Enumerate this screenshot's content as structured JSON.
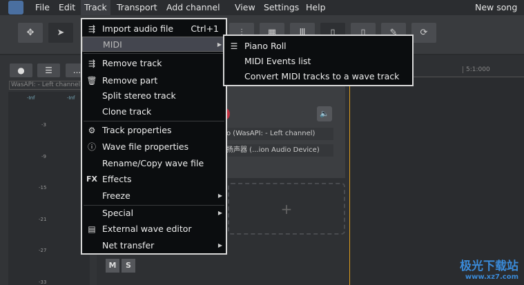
{
  "menubar": {
    "items": [
      "File",
      "Edit",
      "Track",
      "Transport",
      "Add channel",
      "View",
      "Settings",
      "Help"
    ],
    "song_title": "New song"
  },
  "left_panel": {
    "input_label": "WasAPI: - Left channel",
    "meter_left": "-Inf",
    "meter_right": "-Inf",
    "scale": [
      "-3",
      "-9",
      "-15",
      "-21",
      "-27",
      "-33"
    ],
    "more": "..."
  },
  "track": {
    "input_select": "o (WasAPI: - Left channel)",
    "output_select": "扬声器 (...ion  Audio  Device)",
    "add_symbol": "+",
    "mute": "M",
    "solo": "S"
  },
  "ruler": {
    "marker": "5:1:000"
  },
  "track_menu": {
    "items": [
      {
        "label": "Import audio file",
        "shortcut": "Ctrl+1",
        "icon": "import-icon"
      },
      {
        "label": "MIDI",
        "submenu": true
      },
      {
        "label": "Remove track",
        "icon": "remove-track-icon"
      },
      {
        "label": "Remove part",
        "icon": "trash-icon"
      },
      {
        "label": "Split stereo track"
      },
      {
        "label": "Clone track"
      },
      {
        "label": "Track properties",
        "icon": "gear-icon"
      },
      {
        "label": "Wave file properties",
        "icon": "info-icon"
      },
      {
        "label": "Rename/Copy wave file"
      },
      {
        "label": "Effects",
        "icon": "fx-icon",
        "icon_text": "FX"
      },
      {
        "label": "Freeze",
        "submenu": true
      },
      {
        "label": "Special",
        "submenu": true
      },
      {
        "label": "External wave editor",
        "icon": "wave-editor-icon"
      },
      {
        "label": "Net transfer",
        "submenu": true
      }
    ]
  },
  "midi_submenu": {
    "items": [
      "Piano Roll",
      "MIDI Events list",
      "Convert MIDI tracks to a wave track"
    ]
  },
  "watermark": {
    "name": "极光下载站",
    "url": "www.xz7.com"
  }
}
